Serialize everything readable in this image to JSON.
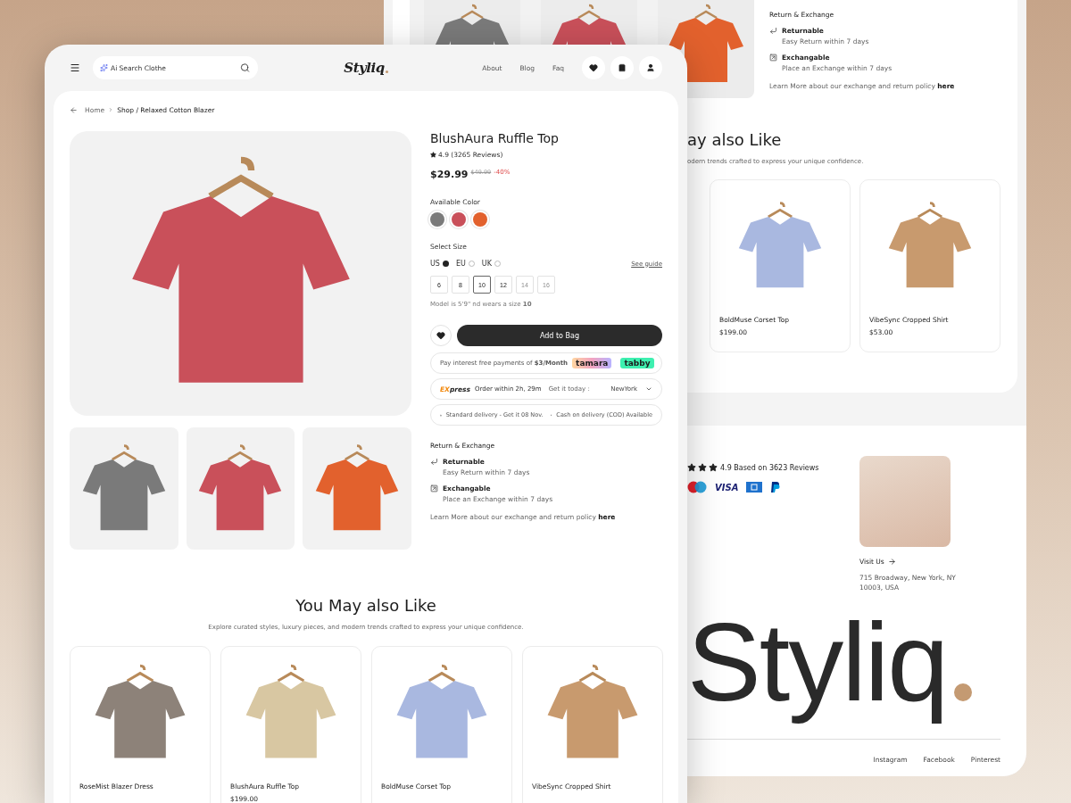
{
  "front": {
    "header": {
      "search": {
        "placeholder": "Ai Search Clothe"
      },
      "logo": "Styliq",
      "nav": [
        "About",
        "Blog",
        "Faq"
      ]
    },
    "breadcrumb": [
      "Home",
      "Shop / Relaxed Cotton Blazer"
    ],
    "product": {
      "title": "BlushAura Ruffle Top",
      "rating": "4.9 (3265 Reviews)",
      "price": "$29.99",
      "old_price": "$49.99",
      "discount": "-40%",
      "color_label": "Available Color",
      "colors": [
        {
          "color": "#7a7a7a"
        },
        {
          "color": "#c9505a"
        },
        {
          "color": "#e2612d"
        }
      ],
      "size_label": "Select Size",
      "systems": [
        {
          "label": "US",
          "selected": true
        },
        {
          "label": "EU",
          "selected": false
        },
        {
          "label": "UK",
          "selected": false
        }
      ],
      "guide": "See guide",
      "sizes": [
        {
          "label": "6",
          "selected": false,
          "disabled": false
        },
        {
          "label": "8",
          "selected": false,
          "disabled": false
        },
        {
          "label": "10",
          "selected": true,
          "disabled": false
        },
        {
          "label": "12",
          "selected": false,
          "disabled": false
        },
        {
          "label": "14",
          "selected": false,
          "disabled": true
        },
        {
          "label": "16",
          "selected": false,
          "disabled": true
        }
      ],
      "model_note": "Model is 5'9\" nd wears a size **10**",
      "cta": "Add to Bag",
      "pay": {
        "text": "Pay interest free payments of **$3/Month**",
        "providers": [
          "tamara",
          "tabby"
        ]
      },
      "express": {
        "logo": "EXpress",
        "order": "Order within 2h, 29m",
        "get": "Get it today :",
        "city": "NewYork"
      },
      "delivery": {
        "standard": "Standard delivery - Get it 08 Nov.",
        "cod": "Cash on delivery (COD) Available"
      },
      "returns": {
        "title": "Return & Exchange",
        "items": [
          {
            "kind": "return",
            "title": "Returnable",
            "text": "Easy Return within 7 days"
          },
          {
            "kind": "exchange",
            "title": "Exchangable",
            "text": "Place an Exchange within 7 days"
          }
        ],
        "note": "Learn More about our exchange and return policy",
        "link": "here"
      }
    },
    "recommend": {
      "title": "You May also Like",
      "subtitle": "Explore curated styles, luxury pieces, and modern trends crafted to express your unique confidence.",
      "products": [
        {
          "name": "RoseMist Blazer Dress"
        },
        {
          "name": "BlushAura Ruffle Top",
          "price": "$199.00"
        },
        {
          "name": "BoldMuse Corset Top"
        },
        {
          "name": "VibeSync Cropped Shirt"
        }
      ]
    }
  },
  "back": {
    "returns": {
      "title": "Return & Exchange",
      "items": [
        {
          "kind": "return",
          "title": "Returnable",
          "text": "Easy Return within 7 days"
        },
        {
          "kind": "exchange",
          "title": "Exchangable",
          "text": "Place an Exchange within 7 days"
        }
      ],
      "note": "Learn More about our exchange and return policy",
      "link": "here"
    },
    "recommend": {
      "title": "ay also Like",
      "subtitle": "odern trends crafted to express your unique confidence.",
      "products": [
        {
          "name": "BoldMuse Corset Top",
          "price": "$199.00"
        },
        {
          "name": "VibeSync Cropped Shirt",
          "price": "$53.00"
        }
      ]
    },
    "footer": {
      "stars": 3,
      "rating": "4.9 Based on 3623 Reviews",
      "payments": [
        {
          "kind": "mastercard"
        },
        {
          "kind": "visa",
          "label": "VISA"
        },
        {
          "kind": "amex"
        },
        {
          "kind": "paypal"
        }
      ],
      "visit": "Visit Us",
      "address": "715 Broadway, New York, NY 10003, USA",
      "logo": "Styliq",
      "links": [
        "Instagram",
        "Facebook",
        "Pinterest"
      ]
    }
  }
}
